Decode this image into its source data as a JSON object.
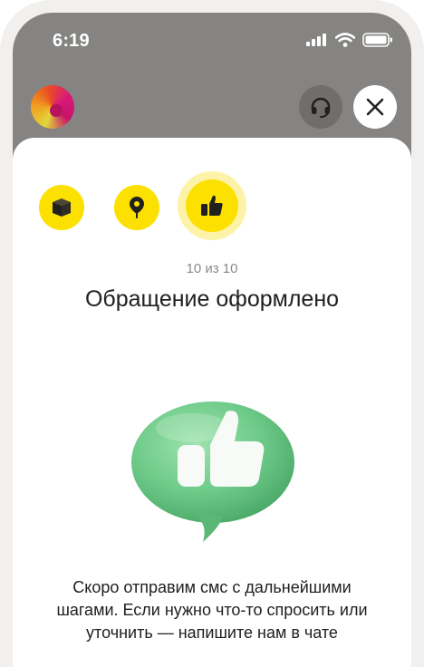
{
  "status_bar": {
    "time": "6:19",
    "icons": [
      "signal-icon",
      "wifi-icon",
      "battery-icon"
    ]
  },
  "header": {
    "avatar": "avatar",
    "support_icon": "headset-icon",
    "close_icon": "close-icon"
  },
  "steps": [
    {
      "icon": "box-icon",
      "state": "done"
    },
    {
      "icon": "location-pin-icon",
      "state": "done"
    },
    {
      "icon": "thumbs-up-icon",
      "state": "current"
    }
  ],
  "progress": {
    "text": "10 из 10",
    "current": 10,
    "total": 10
  },
  "main": {
    "title": "Обращение оформлено",
    "illustration": "thumbs-up-bubble",
    "description": "Скоро отправим смс с дальнейшими шагами. Если нужно что-то спросить или уточнить — напишите нам в чате"
  },
  "colors": {
    "accent": "#fce000",
    "accent_halo": "#fdf3a8",
    "overlay": "#858482",
    "bubble_green": "#6dc98a",
    "text_primary": "#21201f",
    "text_secondary": "#8a8a8a"
  }
}
